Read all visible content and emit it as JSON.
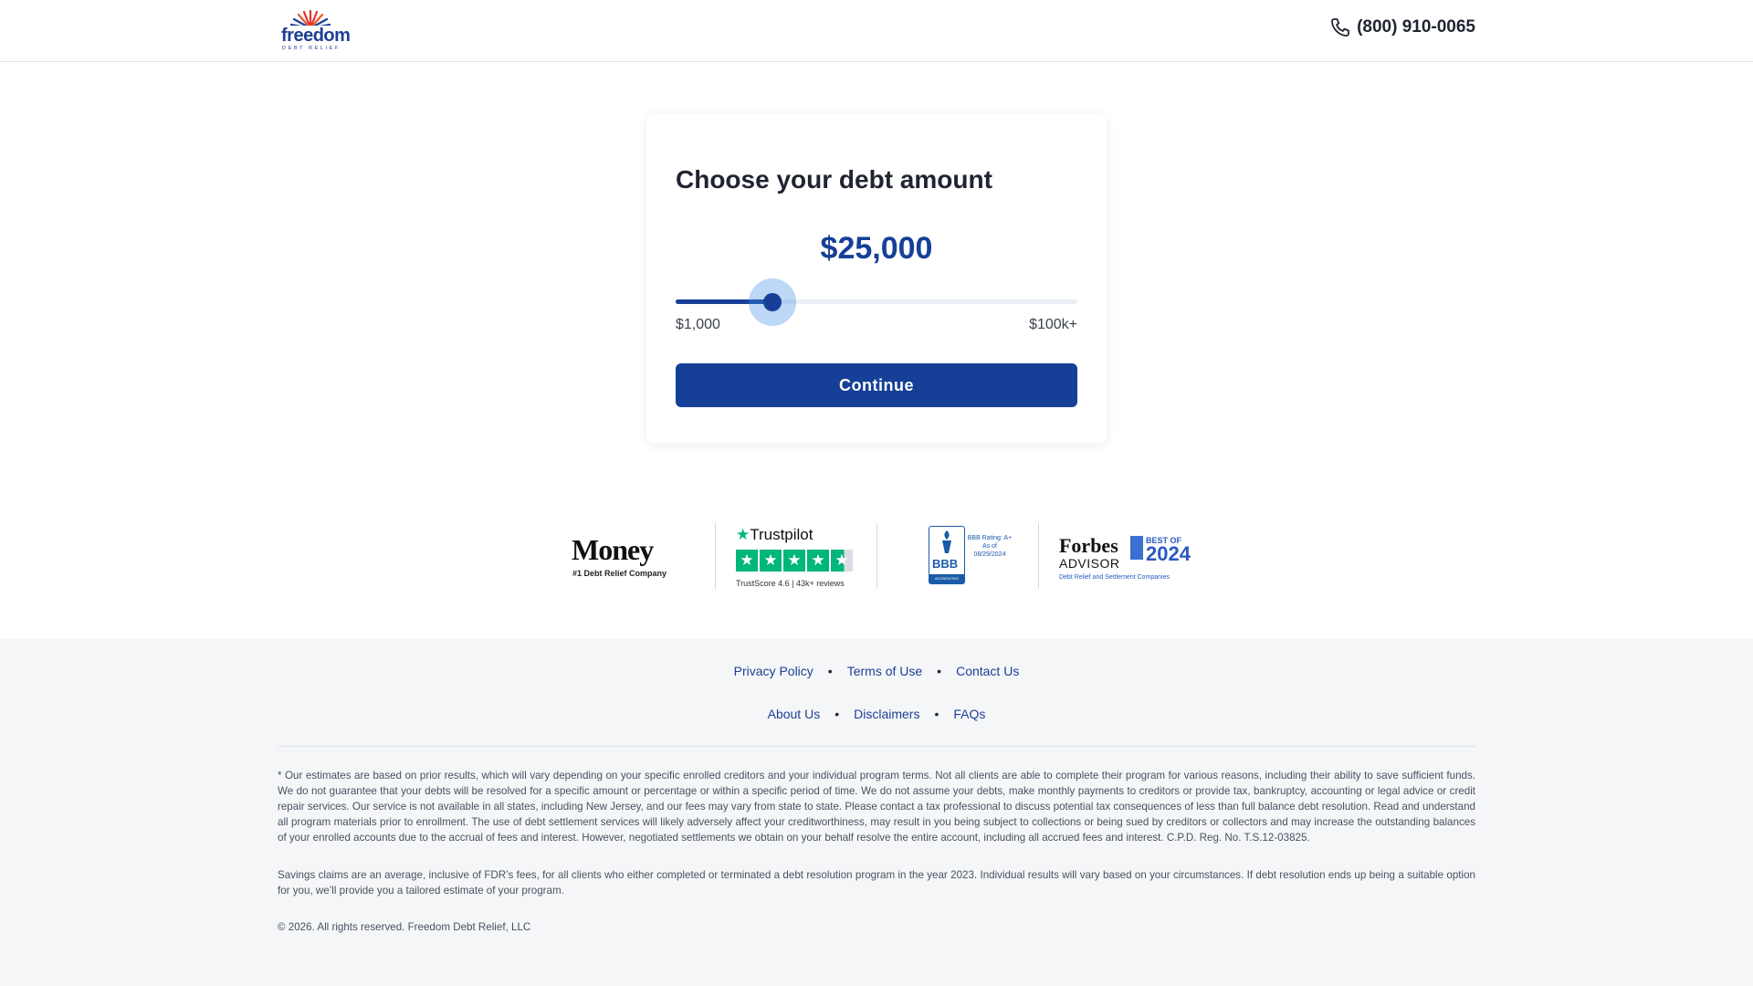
{
  "header": {
    "logo_word": "freedom",
    "logo_sub": "DEBT RELIEF",
    "phone": "(800) 910-0065"
  },
  "form": {
    "title": "Choose your debt amount",
    "amount": "$25,000",
    "slider": {
      "min_label": "$1,000",
      "max_label": "$100k+",
      "fraction": 0.24
    },
    "continue_label": "Continue"
  },
  "badges": {
    "money": {
      "word": "Money",
      "sub": "#1 Debt Relief Company"
    },
    "trustpilot": {
      "word": "Trustpilot",
      "sub": "TrustScore 4.6 | 43k+ reviews"
    },
    "bbb": {
      "text": "BBB",
      "strip": "ACCREDITED BUSINESS",
      "rating": "BBB Rating: A+ As of 08/29/2024"
    },
    "forbes": {
      "word": "Forbes",
      "advisor": "ADVISOR",
      "best_of": "BEST OF",
      "year": "2024",
      "sub": "Debt Relief and Settlement Companies"
    }
  },
  "footer": {
    "links_row1": [
      "Privacy Policy",
      "Terms of Use",
      "Contact Us"
    ],
    "links_row2": [
      "About Us",
      "Disclaimers",
      "FAQs"
    ],
    "disclaimer1": "* Our estimates are based on prior results, which will vary depending on your specific enrolled creditors and your individual program terms. Not all clients are able to complete their program for various reasons, including their ability to save sufficient funds. We do not guarantee that your debts will be resolved for a specific amount or percentage or within a specific period of time. We do not assume your debts, make monthly payments to creditors or provide tax, bankruptcy, accounting or legal advice or credit repair services. Our service is not available in all states, including New Jersey, and our fees may vary from state to state. Please contact a tax professional to discuss potential tax consequences of less than full balance debt resolution. Read and understand all program materials prior to enrollment. The use of debt settlement services will likely adversely affect your creditworthiness, may result in you being subject to collections or being sued by creditors or collectors and may increase the outstanding balances of your enrolled accounts due to the accrual of fees and interest. However, negotiated settlements we obtain on your behalf resolve the entire account, including all accrued fees and interest. C.P.D. Reg. No. T.S.12-03825.",
    "disclaimer2": "Savings claims are an average, inclusive of FDR’s fees, for all clients who either completed or terminated a debt resolution program in the year 2023. Individual results will vary based on your circumstances. If debt resolution ends up being a suitable option for you, we’ll provide you a tailored estimate of your program.",
    "copyright": "© 2026. All rights reserved. Freedom Debt Relief, LLC"
  },
  "colors": {
    "brand": "#163f97",
    "accent_halo": "#428ce6",
    "trustpilot": "#00b67a"
  }
}
